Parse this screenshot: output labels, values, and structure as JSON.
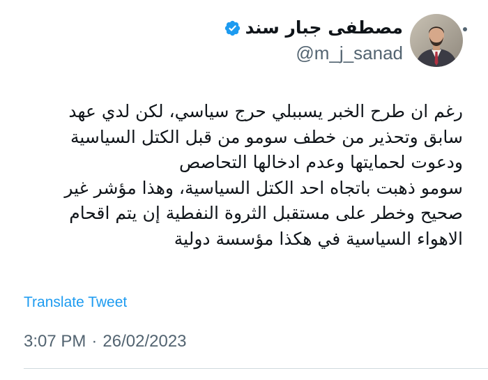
{
  "author": {
    "display_name": "مصطفى جبار سند",
    "handle": "@m_j_sanad",
    "verified": true,
    "verified_icon": "verified-badge-icon",
    "avatar_icon": "profile-photo"
  },
  "tweet": {
    "lines": [
      "رغم ان طرح الخبر يسببلي حرج سياسي، لكن لدي عهد",
      "سابق وتحذير من خطف سومو من قبل الكتل السياسية",
      "ودعوت لحمايتها وعدم ادخالها التحاصص",
      "سومو ذهبت باتجاه احد الكتل السياسية، وهذا مؤشر غير",
      "صحيح وخطر على مستقبل الثروة النفطية إن يتم اقحام",
      "الاهواء السياسية في هكذا مؤسسة دولية"
    ],
    "translate_label": "Translate Tweet",
    "time": "3:07 PM",
    "separator": "·",
    "date": "26/02/2023"
  },
  "menu": {
    "more_icon": "more-horizontal-icon"
  },
  "colors": {
    "accent": "#1d9bf0",
    "text": "#0f1419",
    "secondary_text": "#536471",
    "divider": "#cfd9de"
  }
}
